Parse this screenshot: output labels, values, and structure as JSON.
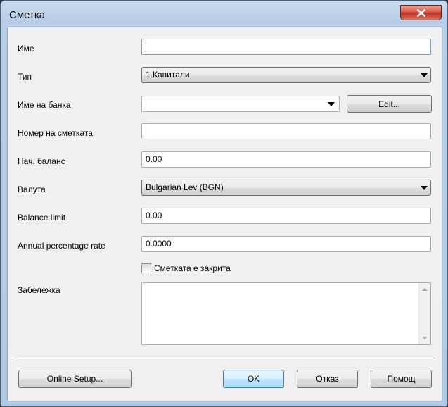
{
  "dialog": {
    "title": "Сметка",
    "close_icon": "close-x-icon"
  },
  "form": {
    "name": {
      "label": "Име",
      "value": ""
    },
    "type": {
      "label": "Тип",
      "selected": "1.Капитали"
    },
    "bank_name": {
      "label": "Име на банка",
      "value": "",
      "edit_label": "Edit..."
    },
    "account_number": {
      "label": "Номер на сметката",
      "value": ""
    },
    "opening_balance": {
      "label": "Нач. баланс",
      "value": "0.00"
    },
    "currency": {
      "label": "Валута",
      "selected": "Bulgarian Lev (BGN)"
    },
    "balance_limit": {
      "label": "Balance limit",
      "value": "0.00"
    },
    "apr": {
      "label": "Annual percentage rate",
      "value": "0.0000"
    },
    "closed": {
      "label": "Сметката е закрита",
      "checked": false
    },
    "note": {
      "label": "Забележка",
      "value": ""
    }
  },
  "buttons": {
    "online_setup": "Online Setup...",
    "ok": "OK",
    "cancel": "Отказ",
    "help": "Помощ"
  }
}
